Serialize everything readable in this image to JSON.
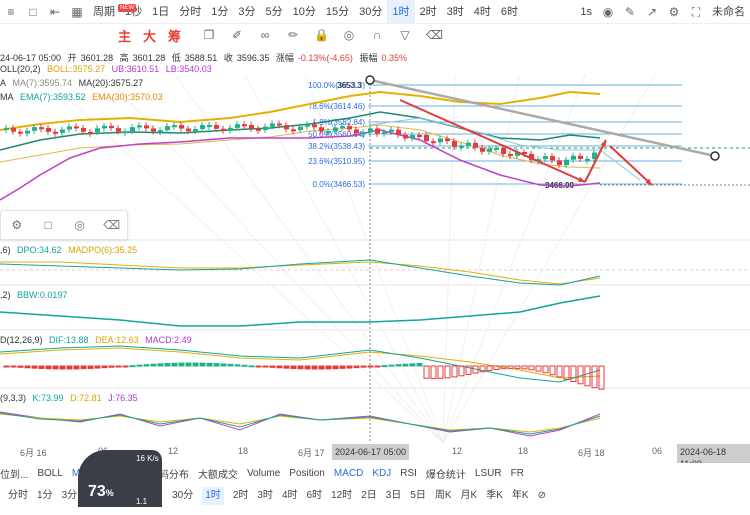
{
  "toolbar": {
    "items": [
      "1秒",
      "1日",
      "分时",
      "1分",
      "3分",
      "5分",
      "10分",
      "15分",
      "30分",
      "1时",
      "2时",
      "3时",
      "4时",
      "6时"
    ],
    "active": "1时",
    "period_label": "周期",
    "new_badge": "NEW",
    "interval_1s": "1s",
    "layout_name": "未命名"
  },
  "drawbar": {
    "zhu": "主",
    "da": "大",
    "chou": "筹"
  },
  "ohlc": {
    "date": "24-06-17 05:00",
    "open_label": "开",
    "open": "3601.28",
    "high_label": "高",
    "high": "3601.28",
    "low_label": "低",
    "low": "3588.51",
    "close_label": "收",
    "close": "3596.35",
    "chg_label": "涨幅",
    "chg": "-0.13%(-4.65)",
    "amp_label": "振幅",
    "amp": "0.35%"
  },
  "boll": {
    "name": "OLL(20,2)",
    "boll": "BOLL:3575.27",
    "ub": "UB:3610.51",
    "lb": "LB:3540.03"
  },
  "ma": {
    "name": "A",
    "ma7": "MA(7):3595.74",
    "ma20": "MA(20):3575.27"
  },
  "ema": {
    "name": "MA",
    "ema7": "EMA(7):3593.52",
    "ema30": "EMA(30):3570.03"
  },
  "fib": [
    {
      "label": "100.0%(3653.3)"
    },
    {
      "label": "78.6%(3614.46)"
    },
    {
      "label": "1.8%(3582.84)"
    },
    {
      "label": "50.0%(3560.64)"
    },
    {
      "label": "38.2%(3538.43)"
    },
    {
      "label": "23.6%(3510.95)"
    },
    {
      "label": "0.0%(3466.53)"
    }
  ],
  "high_mark": "3653.3",
  "low_mark": "3466.00",
  "dpo": {
    "name": ",6)",
    "dpo": "DPO:34.62",
    "madpo": "MADPO(6):35.25"
  },
  "bbw": {
    "name": ",2)",
    "bbw": "BBW:0.0197"
  },
  "macd": {
    "name": "D(12,26,9)",
    "dif": "DIF:13.88",
    "dea": "DEA:12.63",
    "macd": "MACD:2.49"
  },
  "kdj": {
    "name": "(9,3,3)",
    "k": "K:73.99",
    "d": "D:72.81",
    "j": "J:76.35"
  },
  "xaxis": {
    "labels": [
      "6月 16",
      "06",
      "12",
      "18",
      "6月 17",
      "12",
      "18",
      "6月 18",
      "06"
    ],
    "selected_left": "2024-06-17 05:00",
    "selected_right": "2024-06-18 11:00"
  },
  "indicators": [
    "BOLL",
    "MA",
    "EMA",
    "TD",
    "筹码分布",
    "大额成交",
    "Volume",
    "Position",
    "MACD",
    "KDJ",
    "RSI",
    "爆仓统计",
    "LSUR",
    "FR"
  ],
  "indicators_active": [
    "MA",
    "EMA",
    "MACD",
    "KDJ"
  ],
  "indicator_prefix": "位到...",
  "periods": [
    "分时",
    "1分",
    "3分",
    "30分",
    "1时",
    "2时",
    "3时",
    "4时",
    "6时",
    "12时",
    "2日",
    "3日",
    "5日",
    "周K",
    "月K",
    "季K",
    "年K"
  ],
  "period_active": "1时",
  "gauge": {
    "percent": "73",
    "pct_sign": "%",
    "up": "16",
    "up_unit": "K/s",
    "down": "1.1",
    "down_unit": "M/s"
  },
  "colors": {
    "accent": "#2b6de0",
    "up": "#1fb28a",
    "down": "#e33c3c"
  }
}
